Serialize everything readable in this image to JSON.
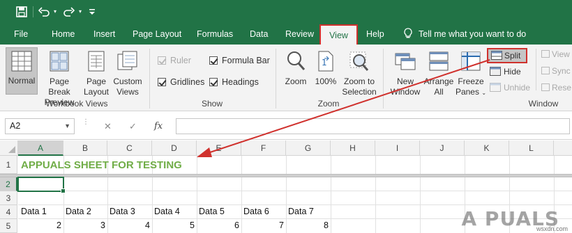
{
  "qat": {
    "save_icon": "save-icon",
    "undo_icon": "undo-icon",
    "redo_icon": "redo-icon",
    "customize_icon": "customize-qat-icon"
  },
  "tabs": [
    {
      "label": "File"
    },
    {
      "label": "Home"
    },
    {
      "label": "Insert"
    },
    {
      "label": "Page Layout"
    },
    {
      "label": "Formulas"
    },
    {
      "label": "Data"
    },
    {
      "label": "Review"
    },
    {
      "label": "View",
      "active": true
    },
    {
      "label": "Help"
    }
  ],
  "tell_me": "Tell me what you want to do",
  "ribbon": {
    "workbook_views": {
      "label": "Workbook Views",
      "normal": "Normal",
      "page_break_1": "Page Break",
      "page_break_2": "Preview",
      "page_layout_1": "Page",
      "page_layout_2": "Layout",
      "custom_views_1": "Custom",
      "custom_views_2": "Views"
    },
    "show": {
      "label": "Show",
      "ruler": {
        "text": "Ruler",
        "checked": true,
        "disabled": true
      },
      "gridlines": {
        "text": "Gridlines",
        "checked": true
      },
      "formula_bar": {
        "text": "Formula Bar",
        "checked": true
      },
      "headings": {
        "text": "Headings",
        "checked": true
      }
    },
    "zoom": {
      "label": "Zoom",
      "zoom": "Zoom",
      "hundred": "100%",
      "zoom_sel_1": "Zoom to",
      "zoom_sel_2": "Selection"
    },
    "window": {
      "label": "Window",
      "new_window_1": "New",
      "new_window_2": "Window",
      "arrange_1": "Arrange",
      "arrange_2": "All",
      "freeze_1": "Freeze",
      "freeze_2": "Panes",
      "split": "Split",
      "hide": "Hide",
      "unhide": "Unhide",
      "view_side": "View",
      "sync": "Sync",
      "reset": "Rese"
    }
  },
  "formula_bar": {
    "name_box": "A2",
    "fx": "fx",
    "cancel": "✕",
    "enter": "✓",
    "value": ""
  },
  "grid": {
    "columns": [
      "A",
      "B",
      "C",
      "D",
      "E",
      "F",
      "G",
      "H",
      "I",
      "J",
      "K",
      "L"
    ],
    "rows": [
      "1",
      "2",
      "3",
      "4",
      "5"
    ],
    "title": "APPUALS SHEET FOR TESTING",
    "headers": [
      "Data 1",
      "Data 2",
      "Data 3",
      "Data 4",
      "Data 5",
      "Data 6",
      "Data 7"
    ],
    "values": [
      "2",
      "3",
      "4",
      "5",
      "6",
      "7",
      "8"
    ],
    "active_cell": "A2"
  },
  "watermark": {
    "text": "A PUALS",
    "site": "wsxdn.com"
  },
  "colors": {
    "excel_green": "#217346",
    "title_green": "#70ad47",
    "highlight_red": "#d0312d"
  }
}
